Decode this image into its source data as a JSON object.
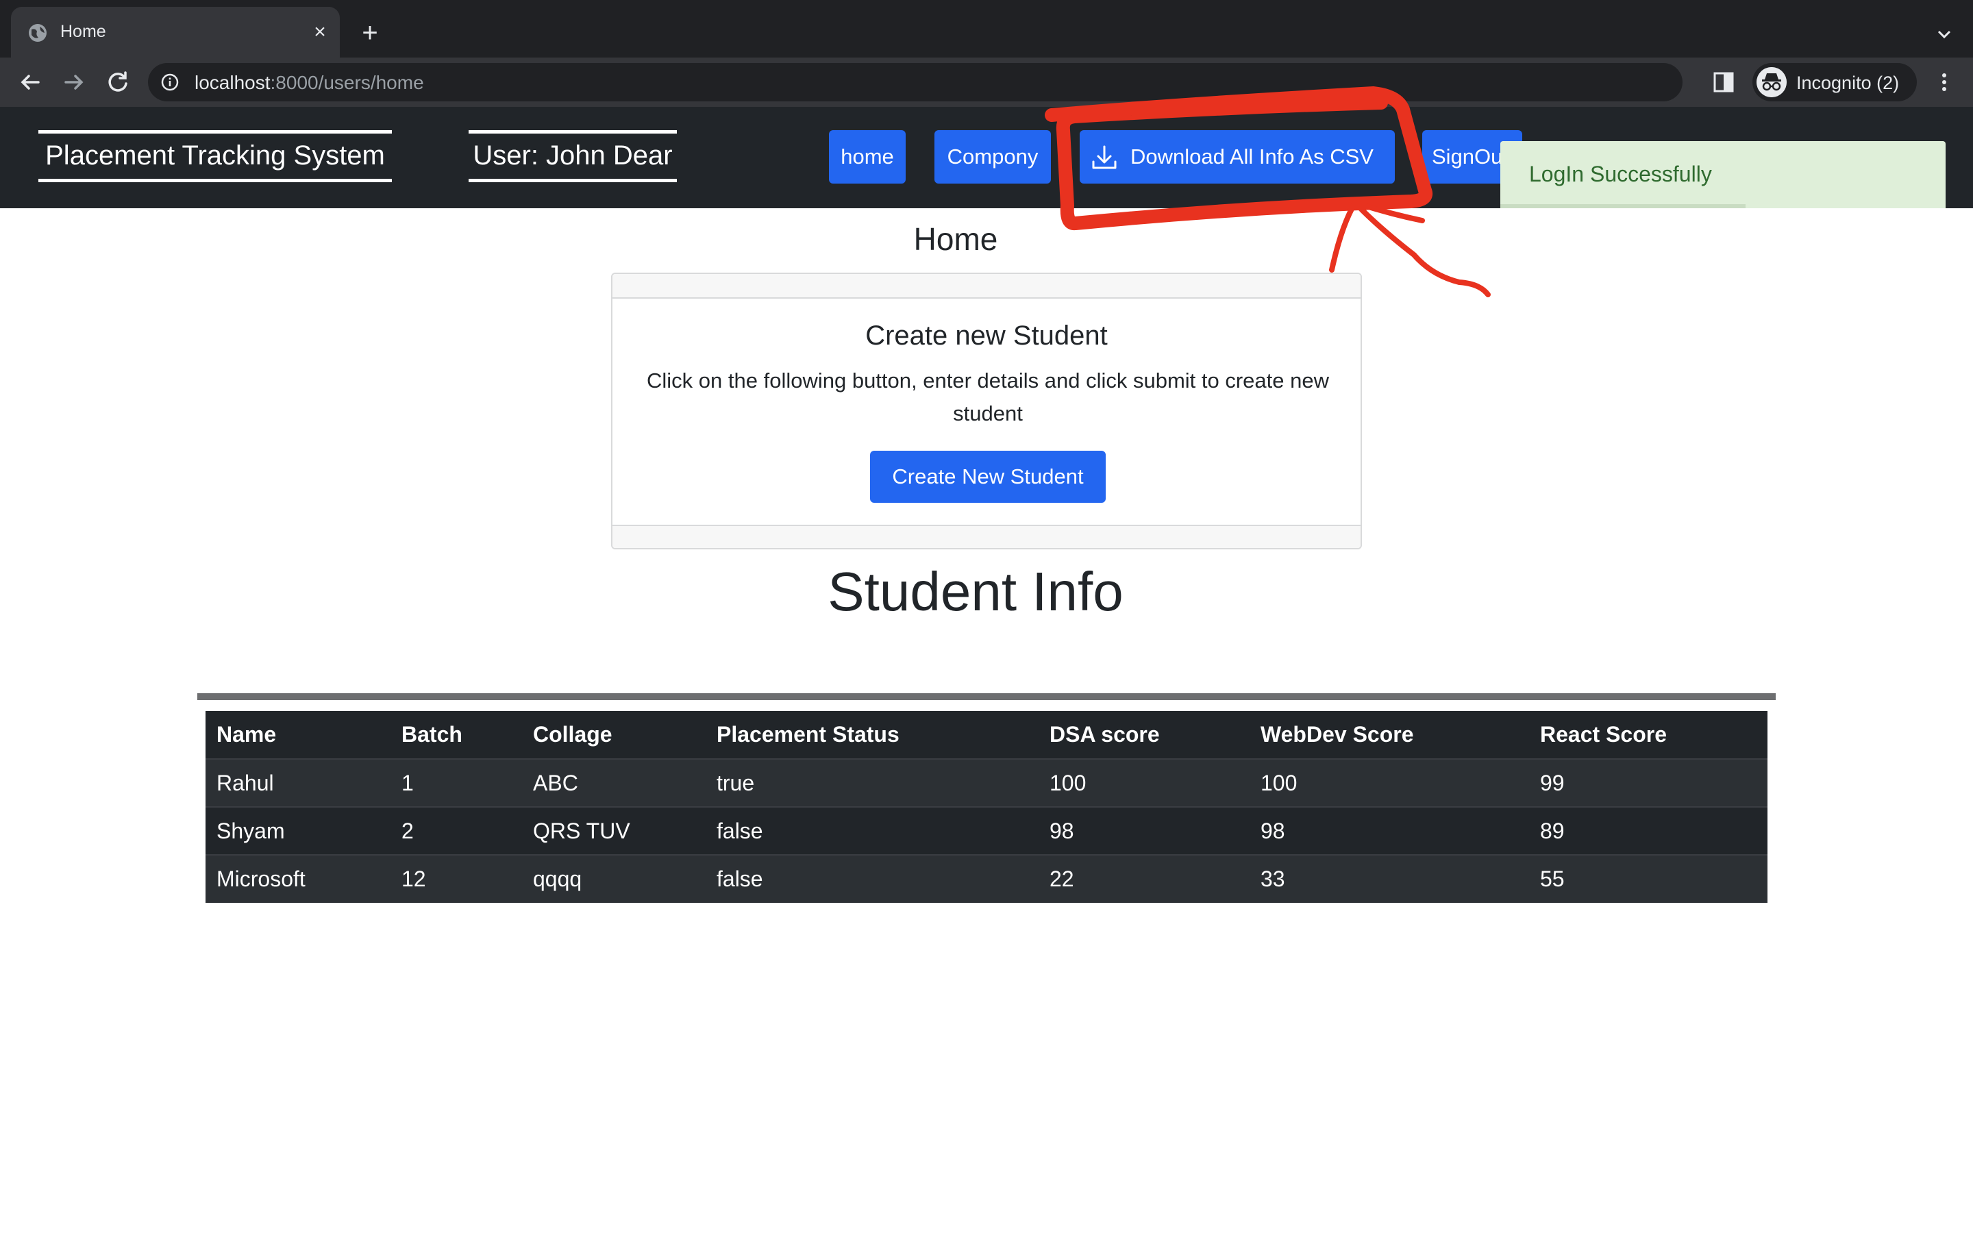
{
  "browser": {
    "tab_title": "Home",
    "url_host": "localhost",
    "url_path": ":8000/users/home",
    "profile_label": "Incognito (2)"
  },
  "navbar": {
    "brand": "Placement Tracking System",
    "user": "User: John Dear",
    "links": {
      "home": "home",
      "company": "Compony",
      "csv": "Download All Info As CSV",
      "signout": "SignOut"
    }
  },
  "toast": {
    "message": "LogIn Successfully",
    "progress": 0.55
  },
  "page": {
    "heading": "Home",
    "card": {
      "title": "Create new Student",
      "text": "Click on the following button, enter details and click submit to create new student",
      "button": "Create New Student"
    },
    "section_title": "Student Info"
  },
  "table": {
    "headers": [
      "Name",
      "Batch",
      "Collage",
      "Placement Status",
      "DSA score",
      "WebDev Score",
      "React Score"
    ],
    "rows": [
      [
        "Rahul",
        "1",
        "ABC",
        "true",
        "100",
        "100",
        "99"
      ],
      [
        "Shyam",
        "2",
        "QRS TUV",
        "false",
        "98",
        "98",
        "89"
      ],
      [
        "Microsoft",
        "12",
        "qqqq",
        "false",
        "22",
        "33",
        "55"
      ]
    ]
  },
  "colors": {
    "primary_button": "#2366f0",
    "navbar_bg": "#212529",
    "toast_bg": "#dfefd9",
    "annotation": "#e8321f"
  }
}
